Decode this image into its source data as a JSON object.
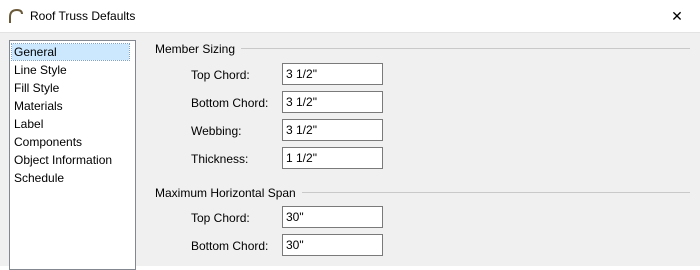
{
  "window": {
    "title": "Roof Truss Defaults",
    "close_glyph": "✕"
  },
  "sidebar": {
    "items": [
      {
        "label": "General",
        "selected": true
      },
      {
        "label": "Line Style",
        "selected": false
      },
      {
        "label": "Fill Style",
        "selected": false
      },
      {
        "label": "Materials",
        "selected": false
      },
      {
        "label": "Label",
        "selected": false
      },
      {
        "label": "Components",
        "selected": false
      },
      {
        "label": "Object Information",
        "selected": false
      },
      {
        "label": "Schedule",
        "selected": false
      }
    ]
  },
  "member_sizing": {
    "title": "Member Sizing",
    "top_chord_label": "Top Chord:",
    "top_chord_value": "3 1/2\"",
    "bottom_chord_label": "Bottom Chord:",
    "bottom_chord_value": "3 1/2\"",
    "webbing_label": "Webbing:",
    "webbing_value": "3 1/2\"",
    "thickness_label": "Thickness:",
    "thickness_value": "1 1/2\""
  },
  "max_span": {
    "title": "Maximum Horizontal Span",
    "top_chord_label": "Top Chord:",
    "top_chord_value": "30\"",
    "bottom_chord_label": "Bottom Chord:",
    "bottom_chord_value": "30\""
  }
}
